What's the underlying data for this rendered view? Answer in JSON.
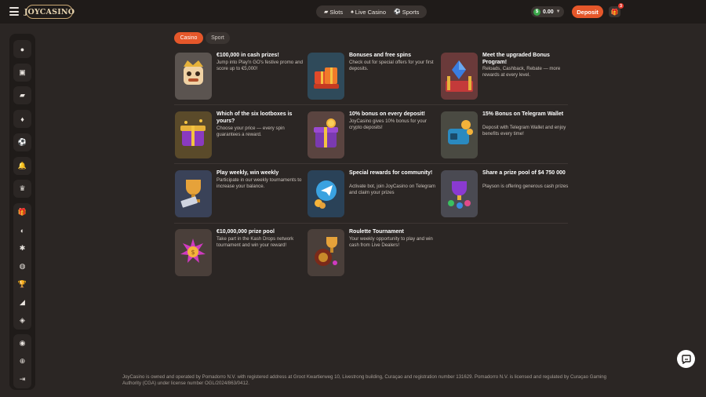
{
  "header": {
    "logo": "JOYCASINO",
    "nav": [
      {
        "label": "Slots",
        "icon": "slots-icon"
      },
      {
        "label": "Live Casino",
        "icon": "live-casino-icon"
      },
      {
        "label": "Sports",
        "icon": "sports-icon"
      }
    ],
    "balance": "0.00",
    "currency_symbol": "$",
    "deposit_label": "Deposit",
    "gift_badge": "3"
  },
  "sidebar": {
    "items": [
      "profile-icon",
      "wallet-icon",
      "slots-icon",
      "cards-icon",
      "sports-ball-icon",
      "notifications-icon",
      "vip-crown-icon",
      "gift-icon",
      "promotions-icon",
      "puzzle-icon",
      "basketball-icon",
      "trophy-icon",
      "chart-icon",
      "tickets-icon",
      "support-icon",
      "language-icon",
      "logout-icon"
    ]
  },
  "tabs": {
    "casino": "Casino",
    "sport": "Sport"
  },
  "promos": [
    {
      "title": "€100,000 in cash prizes!",
      "desc": "Jump into Play'n GO's festive promo and score up to €5,000!"
    },
    {
      "title": "Bonuses and free spins",
      "desc": "Check out for special offers for your first deposits."
    },
    {
      "title": "Meet the upgraded Bonus Program!",
      "desc": "Reloads, Cashback, Rebate — more rewards at every level."
    },
    {
      "title": "Which of the six lootboxes is yours?",
      "desc": "Choose your price — every spin guarantees a reward."
    },
    {
      "title": "10% bonus on every deposit!",
      "desc": "JoyCasino gives 10% bonus for your crypto deposits!"
    },
    {
      "title": "15% Bonus on Telegram Wallet",
      "desc": "Deposit with Telegram Wallet and enjoy benefits every time!"
    },
    {
      "title": "Play weekly, win weekly",
      "desc": "Participate in our weekly tournaments to increase your balance."
    },
    {
      "title": "Special rewards for community!",
      "desc": "Activate bot, join JoyCasino on Telegram and claim your prizes"
    },
    {
      "title": "Share a prize pool of $4 750 000",
      "desc": "Playson is offering generous cash prizes"
    },
    {
      "title": "€10,000,000 prize pool",
      "desc": "Take part in the Kash Drops network tournament and win your reward!"
    },
    {
      "title": "Roulette Tournament",
      "desc": "Your weekly opportunity to play and win cash from Live Dealers!"
    }
  ],
  "footer": "JoyCasino is owned and operated by Pomadorro N.V. with registered address at Groot Kwartierweg 10, Livestrong building, Curaçao and registration number 131629. Pomadorro N.V. is licensed and regulated by Curaçao Gaming Authority (CGA) under license number OGL/2024/863/0412.",
  "colors": {
    "accent": "#e5572a",
    "background": "#2b2624",
    "header": "#1f1b19"
  }
}
